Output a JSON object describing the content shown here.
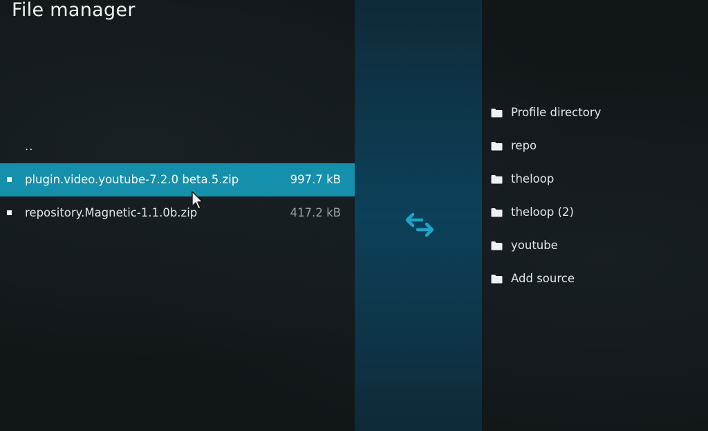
{
  "header": {
    "title": "File manager"
  },
  "left_pane": {
    "parent_label": "..",
    "files": [
      {
        "name": "plugin.video.youtube-7.2.0 beta.5.zip",
        "size": "997.7 kB",
        "selected": true
      },
      {
        "name": "repository.Magnetic-1.1.0b.zip",
        "size": "417.2 kB",
        "selected": false
      }
    ]
  },
  "center": {
    "swap_icon": "swap-arrows-icon"
  },
  "right_pane": {
    "sources": [
      {
        "label": "Profile directory",
        "icon": "folder-icon"
      },
      {
        "label": "repo",
        "icon": "folder-icon"
      },
      {
        "label": "theloop",
        "icon": "folder-icon"
      },
      {
        "label": "theloop (2)",
        "icon": "folder-icon"
      },
      {
        "label": "youtube",
        "icon": "folder-icon"
      },
      {
        "label": "Add source",
        "icon": "folder-icon"
      }
    ]
  },
  "colors": {
    "background": "#111619",
    "selection": "#148fac",
    "center_column": "#0c4159",
    "swap_icon": "#1fa3c9"
  }
}
